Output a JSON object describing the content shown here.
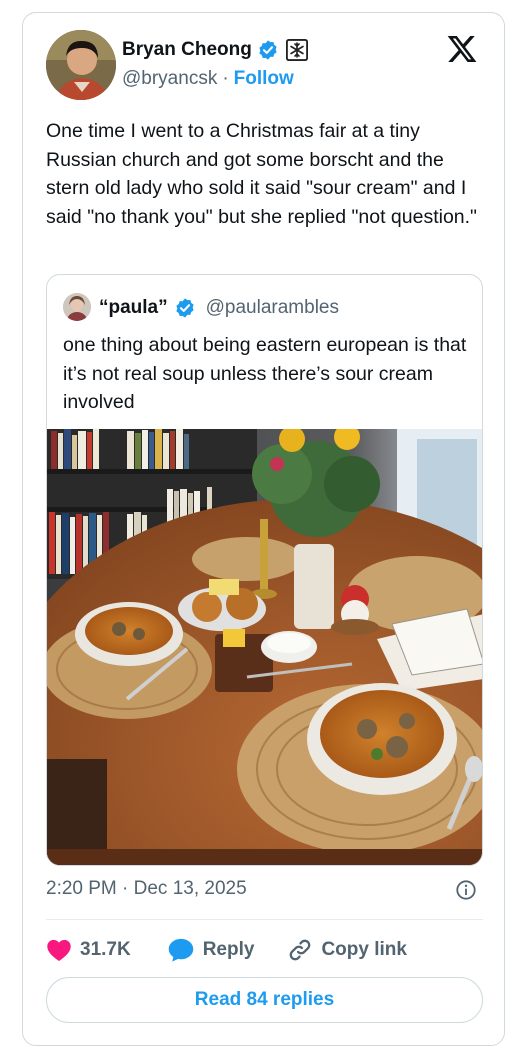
{
  "author": {
    "name": "Bryan Cheong",
    "handle": "@bryancsk",
    "separator": "·",
    "follow_label": "Follow"
  },
  "tweet": {
    "text": "One time I went to a Christmas fair at a tiny Russian church and got some borscht and the stern old lady who sold it said \"sour cream\" and I said \"no thank you\" but she replied \"not question.\""
  },
  "quote": {
    "name": "“paula”",
    "handle": "@paularambles",
    "text": "one thing about being eastern european is that it’s not real soup unless there’s sour cream involved"
  },
  "meta": {
    "time": "2:20 PM · Dec 13, 2025"
  },
  "actions": {
    "likes": "31.7K",
    "reply_label": "Reply",
    "copy_label": "Copy link"
  },
  "read_replies_label": "Read 84 replies",
  "colors": {
    "accent": "#1d9bf0",
    "heart": "#f91880",
    "secondary_text": "#536471",
    "border": "#cfd9de"
  },
  "icons": [
    "verified-badge-icon",
    "snowflake-badge-icon",
    "x-logo-icon",
    "info-icon",
    "heart-icon",
    "reply-bubble-icon",
    "link-icon"
  ]
}
